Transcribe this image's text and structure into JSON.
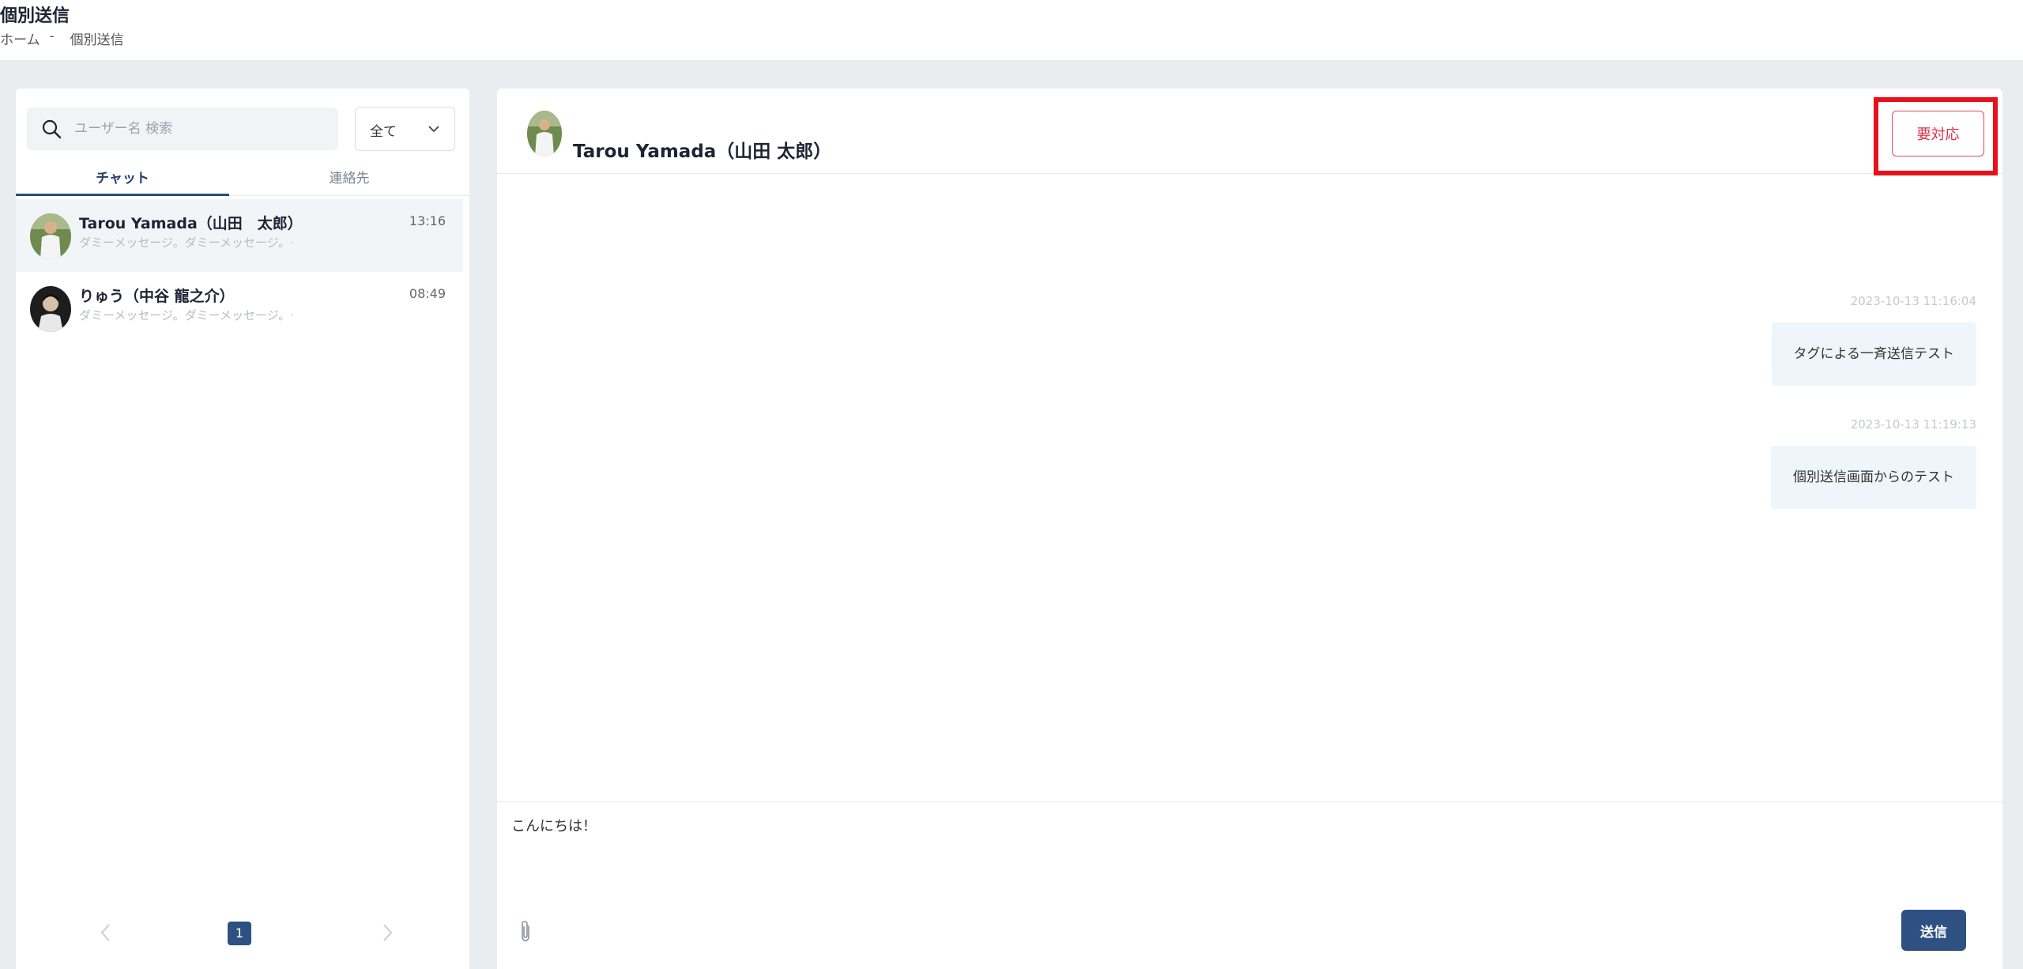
{
  "header": {
    "title": "個別送信",
    "breadcrumb": {
      "home": "ホーム",
      "separator": "-",
      "current": "個別送信"
    }
  },
  "sidebar": {
    "search": {
      "placeholder": "ユーザー名 検索",
      "value": ""
    },
    "filter": {
      "selected": "全て"
    },
    "tabs": [
      {
        "label": "チャット",
        "active": true
      },
      {
        "label": "連絡先",
        "active": false
      }
    ],
    "chats": [
      {
        "name": "Tarou Yamada（山田　太郎）",
        "preview": "ダミーメッセージ。ダミーメッセージ。ダ...",
        "time": "13:16",
        "active": true
      },
      {
        "name": "りゅう（中谷 龍之介）",
        "preview": "ダミーメッセージ。ダミーメッセージ。ダ...",
        "time": "08:49",
        "active": false
      }
    ],
    "pagination": {
      "current": "1"
    }
  },
  "conversation": {
    "name": "Tarou Yamada（山田 太郎）",
    "needs_action_label": "要対応",
    "messages": [
      {
        "timestamp": "2023-10-13 11:16:04",
        "text": "タグによる一斉送信テスト"
      },
      {
        "timestamp": "2023-10-13 11:19:13",
        "text": "個別送信画面からのテスト"
      }
    ],
    "composer": {
      "value": "こんにちは！"
    },
    "send_label": "送信"
  },
  "colors": {
    "primary": "#2f5082",
    "highlight": "#e8101a",
    "needs_action": "#d5334a",
    "bubble": "#eef6fc"
  }
}
